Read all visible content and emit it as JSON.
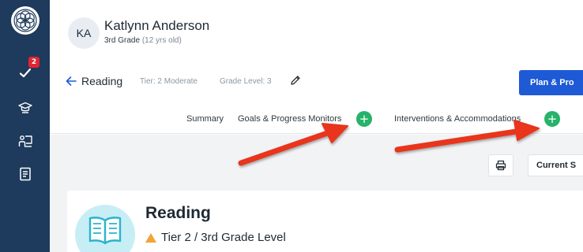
{
  "student": {
    "initials": "KA",
    "name": "Katlynn Anderson",
    "grade": "3rd Grade",
    "age": "(12 yrs old)"
  },
  "sidebar": {
    "badge_count": "2",
    "icons": [
      "logo-icon",
      "checkmark-icon",
      "graduation-cap-icon",
      "teacher-board-icon",
      "notebook-icon"
    ]
  },
  "breadcrumb": {
    "title": "Reading",
    "tier": "Tier: 2 Moderate",
    "grade_level": "Grade Level: 3"
  },
  "toolbar": {
    "plan_label": "Plan & Pro",
    "current_label": "Current S"
  },
  "tabs": [
    {
      "label": "Summary"
    },
    {
      "label": "Goals & Progress Monitors"
    },
    {
      "label": "Interventions & Accommodations"
    }
  ],
  "plus_symbol": "+",
  "card": {
    "title": "Reading",
    "tier_line": "Tier 2 / 3rd Grade Level"
  },
  "colors": {
    "sidebar": "#1e3a5c",
    "primary": "#1e5ad6",
    "add": "#27b36a",
    "badge": "#e02533",
    "annotation": "#e8341c",
    "tier_warning": "#f2a33a"
  }
}
